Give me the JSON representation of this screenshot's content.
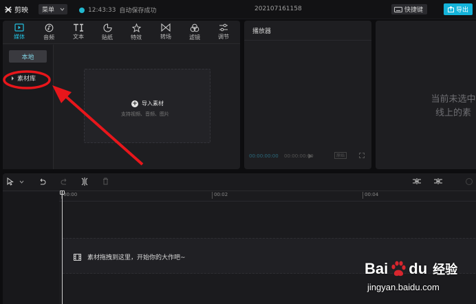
{
  "titlebar": {
    "app_name": "剪映",
    "menu_label": "菜单",
    "save_time": "12:43:33",
    "save_text": "自动保存成功",
    "project_name": "202107161158",
    "shortcut_label": "快捷键",
    "export_label": "导出"
  },
  "media_toolbar": {
    "tabs": [
      {
        "label": "媒体",
        "icon": "media-icon",
        "active": true
      },
      {
        "label": "音频",
        "icon": "audio-icon"
      },
      {
        "label": "文本",
        "icon": "text-icon"
      },
      {
        "label": "贴纸",
        "icon": "sticker-icon"
      },
      {
        "label": "特效",
        "icon": "effects-icon"
      },
      {
        "label": "转场",
        "icon": "transition-icon"
      },
      {
        "label": "滤镜",
        "icon": "filter-icon"
      },
      {
        "label": "调节",
        "icon": "adjust-icon"
      }
    ]
  },
  "media_side": {
    "local_label": "本地",
    "library_label": "素材库"
  },
  "drop_zone": {
    "import_label": "导入素材",
    "hint": "支持视频、音频、图片"
  },
  "player": {
    "title": "播放器",
    "time_current": "00:00:00:00",
    "time_total": "00:00:00:00",
    "ratio_label": "原始"
  },
  "properties": {
    "empty_text_line1": "当前未选中",
    "empty_text_line2": "线上的素"
  },
  "timeline": {
    "ruler_labels": [
      "00:00",
      "00:02",
      "00:04"
    ],
    "drop_hint": "素材拖拽到这里，开始你的大作吧~"
  },
  "watermark": {
    "brand_left": "Bai",
    "brand_right": "du",
    "product": "经验",
    "url": "jingyan.baidu.com"
  },
  "colors": {
    "accent": "#22c0e0",
    "export_button": "#14b3d9",
    "annotation_red": "#e8161b"
  }
}
